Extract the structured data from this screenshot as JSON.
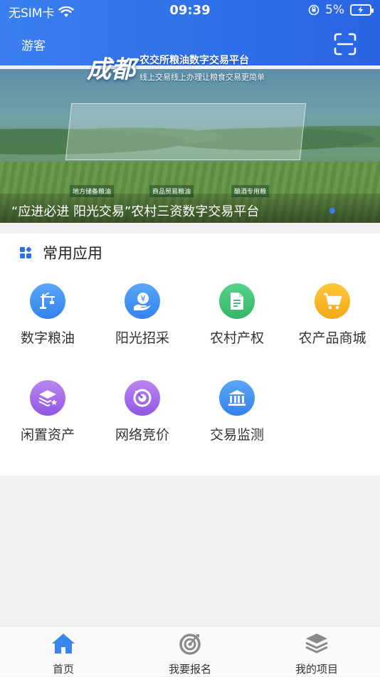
{
  "status_bar": {
    "carrier": "无SIM卡",
    "time": "09:39",
    "battery": "5%"
  },
  "header": {
    "guest_label": "游客"
  },
  "banner": {
    "city": "成都",
    "subtitle_main": "农交所粮油数字交易平台",
    "subtitle_line": "线上交易线上办理让粮食交易更简单",
    "tags": [
      "地方储备粮油",
      "商品贸易粮油",
      "酿酒专用粮"
    ],
    "caption": "“应进必进 阳光交易”农村三资数字交易平台"
  },
  "apps": {
    "title": "常用应用",
    "items": [
      {
        "label": "数字粮油",
        "icon": "crane-icon",
        "color": "#3d8ff0"
      },
      {
        "label": "阳光招采",
        "icon": "money-hand-icon",
        "color": "#3d8ff0"
      },
      {
        "label": "农村产权",
        "icon": "document-icon",
        "color": "#3ec272"
      },
      {
        "label": "农产品商城",
        "icon": "cart-icon",
        "color": "#f5b21a"
      },
      {
        "label": "闲置资产",
        "icon": "layers-star-icon",
        "color": "#a469e8"
      },
      {
        "label": "网络竞价",
        "icon": "target-icon",
        "color": "#a469e8"
      },
      {
        "label": "交易监测",
        "icon": "bank-icon",
        "color": "#3d8ff0"
      }
    ]
  },
  "tabbar": {
    "tabs": [
      {
        "label": "首页",
        "icon": "home-icon",
        "active": true
      },
      {
        "label": "我要报名",
        "icon": "target-icon",
        "active": false
      },
      {
        "label": "我的项目",
        "icon": "layers-icon",
        "active": false
      }
    ],
    "active_color": "#3a86f0",
    "inactive_color": "#8a8a8a"
  }
}
